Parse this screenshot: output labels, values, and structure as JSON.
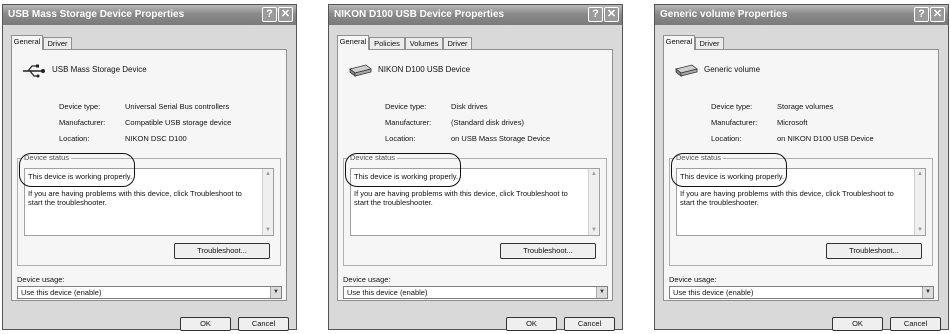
{
  "usb_icon": "usb-plug-icon",
  "drive_icon": "disk-drive-icon",
  "dialogs": [
    {
      "title": "USB Mass Storage Device Properties",
      "tabs": [
        "General",
        "Driver"
      ],
      "device_name": "USB Mass Storage Device",
      "device_type_label": "Device type:",
      "device_type": "Universal Serial Bus controllers",
      "manufacturer_label": "Manufacturer:",
      "manufacturer": "Compatible USB storage device",
      "location_label": "Location:",
      "location": "NIKON DSC D100",
      "status_legend": "Device status",
      "status_text": "This device is working properly.",
      "status_help": "If you are having problems with this device, click Troubleshoot to start the troubleshooter.",
      "troubleshoot_label": "Troubleshoot...",
      "usage_label": "Device usage:",
      "usage_value": "Use this device (enable)",
      "ok_label": "OK",
      "cancel_label": "Cancel"
    },
    {
      "title": "NIKON D100 USB Device Properties",
      "tabs": [
        "General",
        "Policies",
        "Volumes",
        "Driver"
      ],
      "device_name": "NIKON D100 USB Device",
      "device_type_label": "Device type:",
      "device_type": "Disk drives",
      "manufacturer_label": "Manufacturer:",
      "manufacturer": "(Standard disk drives)",
      "location_label": "Location:",
      "location": "on USB Mass Storage Device",
      "status_legend": "Device status",
      "status_text": "This device is working properly.",
      "status_help": "If you are having problems with this device, click Troubleshoot to start the troubleshooter.",
      "troubleshoot_label": "Troubleshoot...",
      "usage_label": "Device usage:",
      "usage_value": "Use this device (enable)",
      "ok_label": "OK",
      "cancel_label": "Cancel"
    },
    {
      "title": "Generic volume Properties",
      "tabs": [
        "General",
        "Driver"
      ],
      "device_name": "Generic volume",
      "device_type_label": "Device type:",
      "device_type": "Storage volumes",
      "manufacturer_label": "Manufacturer:",
      "manufacturer": "Microsoft",
      "location_label": "Location:",
      "location": "on NIKON D100 USB Device",
      "status_legend": "Device status",
      "status_text": "This device is working properly.",
      "status_help": "If you are having problems with this device, click Troubleshoot to start the troubleshooter.",
      "troubleshoot_label": "Troubleshoot...",
      "usage_label": "Device usage:",
      "usage_value": "Use this device (enable)",
      "ok_label": "OK",
      "cancel_label": "Cancel"
    }
  ]
}
